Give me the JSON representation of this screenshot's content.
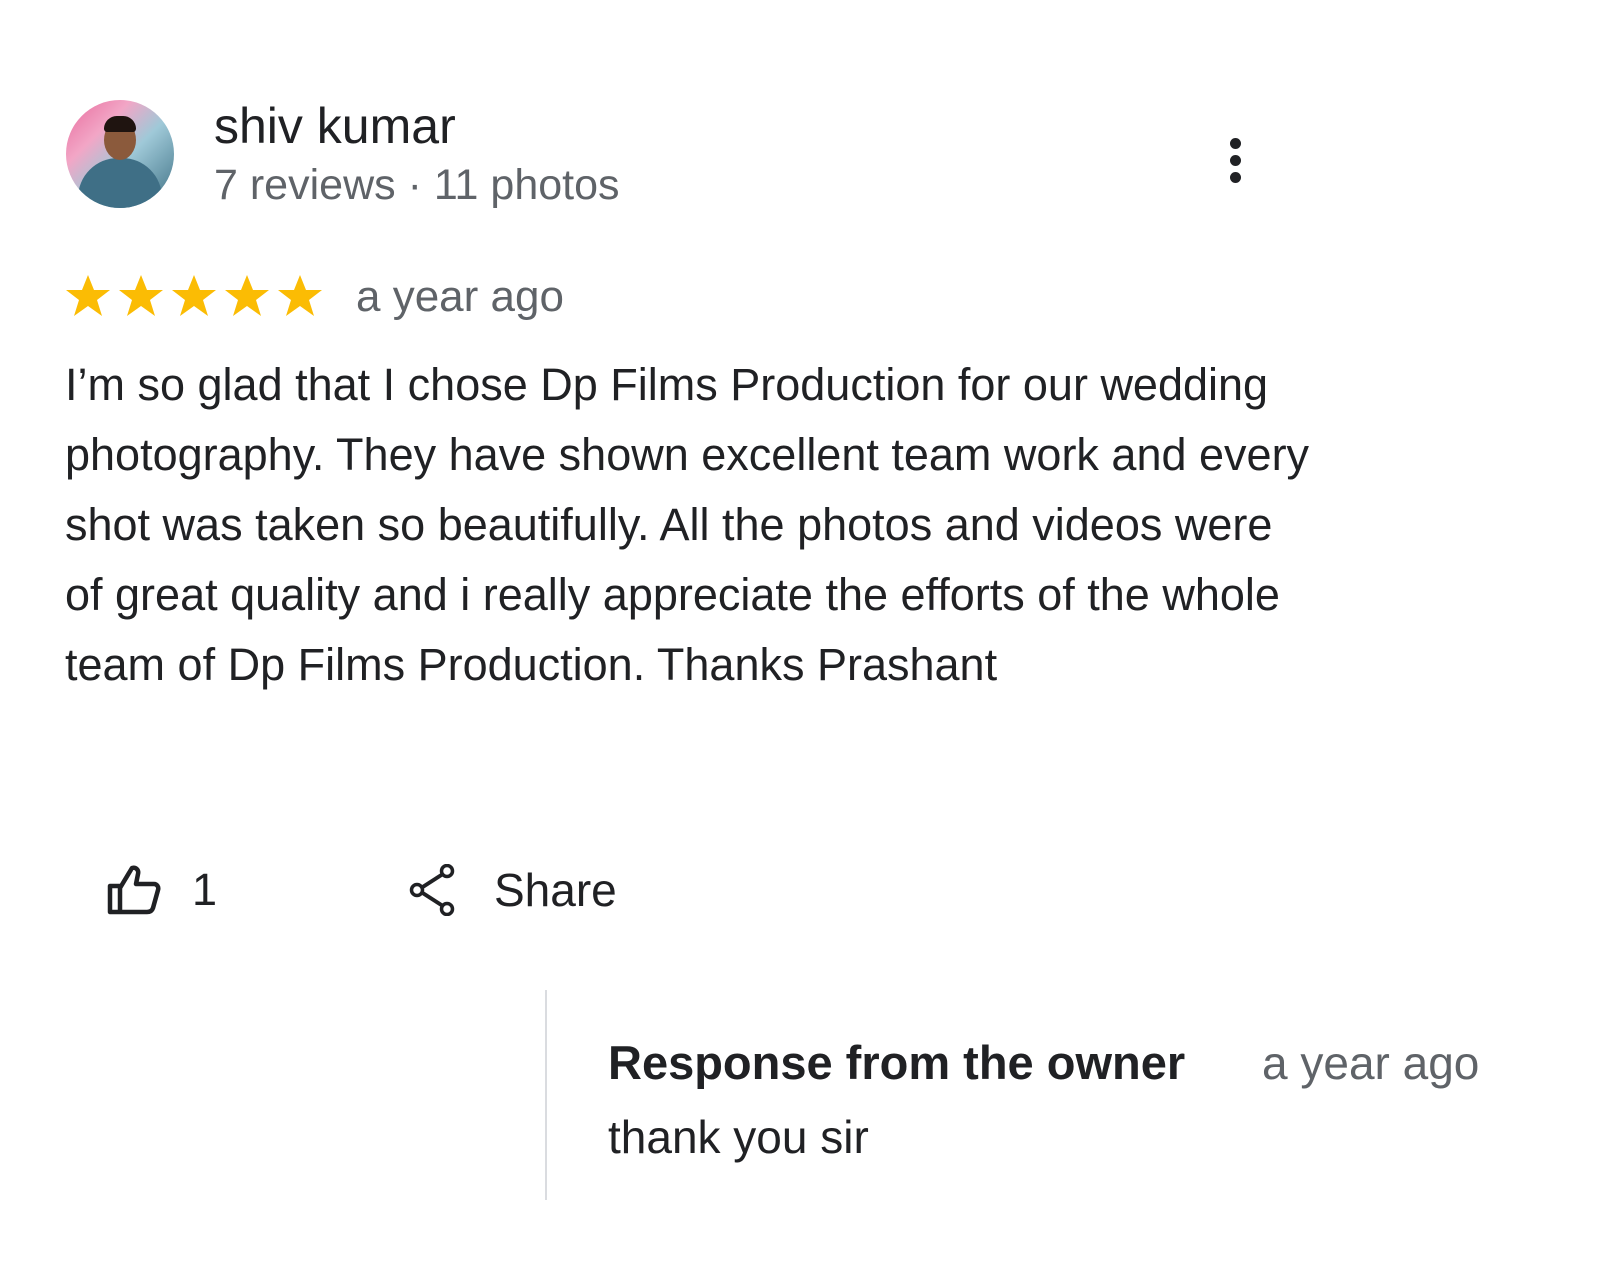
{
  "author": {
    "name": "shiv kumar",
    "meta": "7 reviews · 11 photos",
    "avatar_icon": "user-avatar-photo"
  },
  "menu": {
    "icon": "more-vert-icon"
  },
  "rating": {
    "stars": 5,
    "max": 5,
    "color": "#fbbc04",
    "time": "a year ago"
  },
  "review": {
    "text": "I’m so glad that I chose Dp Films Production for our wedding photography. They have shown excellent team work and every shot was taken so beautifully. All the photos and videos were of great quality and i really appreciate the efforts of the whole team of Dp Films Production. Thanks Prashant"
  },
  "actions": {
    "like_icon": "thumb-up-icon",
    "like_count": "1",
    "share_icon": "share-icon",
    "share_label": "Share"
  },
  "owner_response": {
    "title": "Response from the owner",
    "time": "a year ago",
    "text": "thank you sir"
  }
}
